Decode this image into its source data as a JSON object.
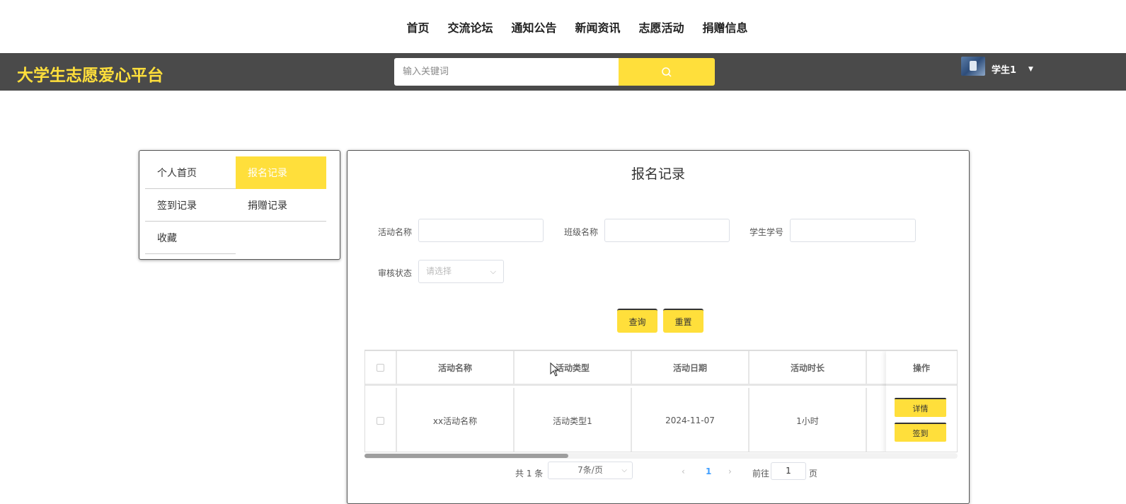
{
  "nav": {
    "items": [
      "首页",
      "交流论坛",
      "通知公告",
      "新闻资讯",
      "志愿活动",
      "捐赠信息"
    ]
  },
  "header": {
    "logo": "大学生志愿爱心平台",
    "search_placeholder": "输入关键词",
    "user_name": "学生1"
  },
  "sidebar": {
    "items": [
      {
        "label": "个人首页",
        "active": false
      },
      {
        "label": "报名记录",
        "active": true
      },
      {
        "label": "签到记录",
        "active": false
      },
      {
        "label": "捐赠记录",
        "active": false
      },
      {
        "label": "收藏",
        "active": false
      }
    ]
  },
  "main": {
    "title": "报名记录",
    "filters": {
      "activity_name_label": "活动名称",
      "class_name_label": "班级名称",
      "student_id_label": "学生学号",
      "review_status_label": "审核状态",
      "review_status_placeholder": "请选择"
    },
    "buttons": {
      "query": "查询",
      "reset": "重置"
    },
    "table": {
      "columns": [
        "活动名称",
        "活动类型",
        "活动日期",
        "活动时长",
        "操作"
      ],
      "rows": [
        {
          "name": "xx活动名称",
          "type": "活动类型1",
          "date": "2024-11-07",
          "duration": "1小时"
        }
      ],
      "row_actions": {
        "detail": "详情",
        "signin": "签到"
      }
    },
    "pagination": {
      "total": "共 1 条",
      "page_size": "7条/页",
      "current_page": "1",
      "goto_label": "前往",
      "goto_value": "1",
      "page_suffix": "页"
    }
  },
  "colors": {
    "accent": "#ffdf3b",
    "header_bg": "#4a4a4a",
    "link_active": "#409eff"
  }
}
